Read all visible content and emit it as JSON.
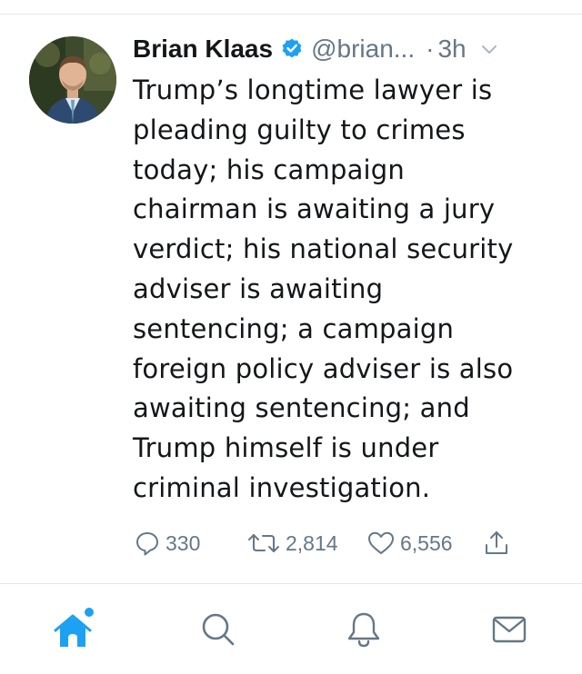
{
  "tweet": {
    "author": {
      "display_name": "Brian Klaas",
      "handle": "@brian...",
      "verified": true,
      "avatar_icon": "profile-photo"
    },
    "separator": "·",
    "timestamp": "3h",
    "text_lines": [
      "Trump’s longtime lawyer is",
      "pleading guilty to crimes",
      "today; his campaign",
      "chairman is awaiting a jury",
      "verdict; his national security",
      "adviser is awaiting",
      "sentencing; a campaign",
      "foreign policy adviser is also",
      "awaiting sentencing; and",
      "Trump himself is under",
      "criminal investigation."
    ],
    "actions": {
      "reply_count": "330",
      "retweet_count": "2,814",
      "like_count": "6,556"
    }
  },
  "tab_bar": {
    "items": [
      {
        "icon": "home-icon",
        "active": true,
        "has_notification_dot": true
      },
      {
        "icon": "search-icon",
        "active": false
      },
      {
        "icon": "bell-icon",
        "active": false
      },
      {
        "icon": "mail-icon",
        "active": false
      }
    ]
  },
  "colors": {
    "accent": "#1da1f2",
    "text_primary": "#14171a",
    "text_secondary": "#657786",
    "divider": "#e1e8ed"
  }
}
